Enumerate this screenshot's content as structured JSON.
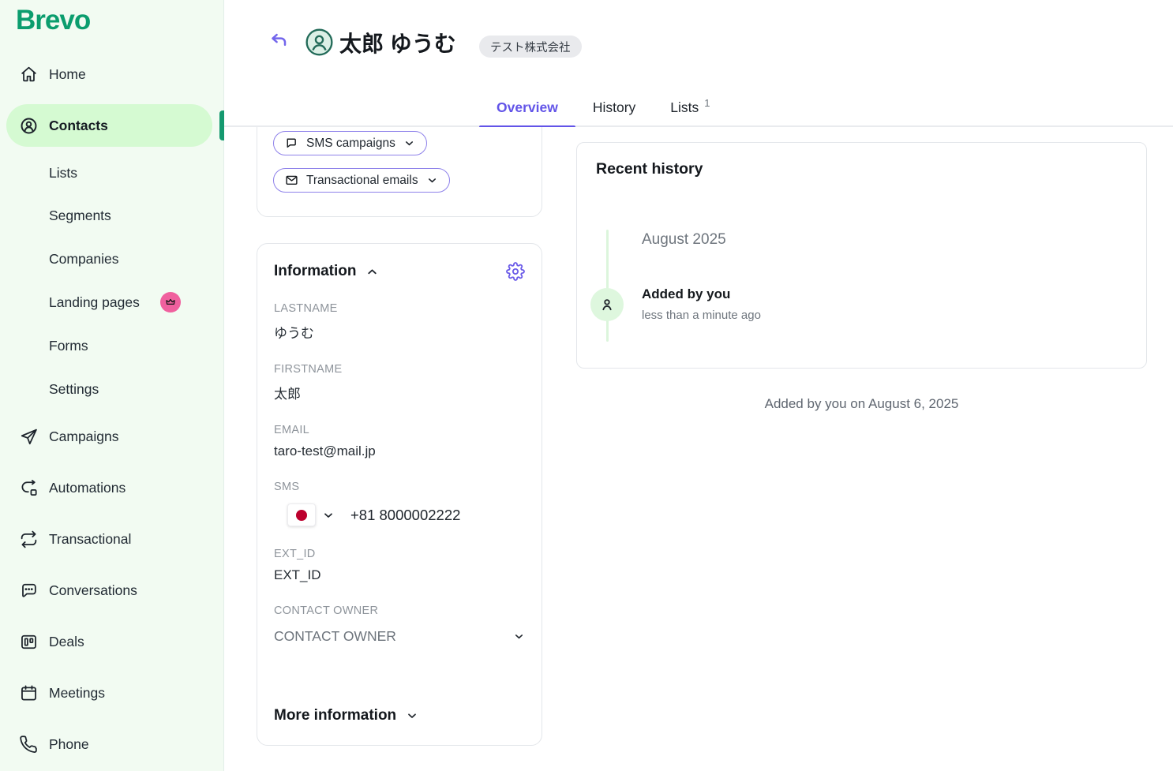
{
  "brand": {
    "logo": "Brevo"
  },
  "sidebar": {
    "items": [
      {
        "label": "Home"
      },
      {
        "label": "Contacts",
        "active": true
      },
      {
        "label": "Lists"
      },
      {
        "label": "Segments"
      },
      {
        "label": "Companies"
      },
      {
        "label": "Landing pages",
        "badge": "crown"
      },
      {
        "label": "Forms"
      },
      {
        "label": "Settings"
      },
      {
        "label": "Campaigns"
      },
      {
        "label": "Automations"
      },
      {
        "label": "Transactional"
      },
      {
        "label": "Conversations"
      },
      {
        "label": "Deals"
      },
      {
        "label": "Meetings"
      },
      {
        "label": "Phone"
      }
    ]
  },
  "header": {
    "title": "太郎 ゆうむ",
    "company_badge": "テスト株式会社"
  },
  "tabs": {
    "overview": "Overview",
    "history": "History",
    "lists": "Lists",
    "lists_count": "1"
  },
  "engagement": {
    "sms_campaigns": "SMS campaigns",
    "transactional_emails": "Transactional emails"
  },
  "information": {
    "title": "Information",
    "fields": {
      "lastname": {
        "label": "LASTNAME",
        "value": "ゆうむ"
      },
      "firstname": {
        "label": "FIRSTNAME",
        "value": "太郎"
      },
      "email": {
        "label": "EMAIL",
        "value": "taro-test@mail.jp"
      },
      "sms": {
        "label": "SMS",
        "value": "+81 8000002222",
        "country": "JP"
      },
      "ext_id": {
        "label": "EXT_ID",
        "value": "EXT_ID"
      },
      "contact_owner": {
        "label": "CONTACT OWNER",
        "value": "CONTACT OWNER"
      }
    },
    "more_label": "More information"
  },
  "recent_history": {
    "title": "Recent history",
    "month": "August 2025",
    "event": {
      "title": "Added by you",
      "time": "less than a minute ago"
    }
  },
  "footer_note": "Added by you on August 6, 2025",
  "colors": {
    "brand_green": "#0b9d6e",
    "sidebar_bg": "#f2fbf2",
    "active_pill_green": "#d5fad2",
    "accent_purple": "#6254e8",
    "crown_badge_pink": "#f0609e",
    "japan_flag_red": "#bc002d",
    "timeline_green": "#dcf5dc"
  }
}
